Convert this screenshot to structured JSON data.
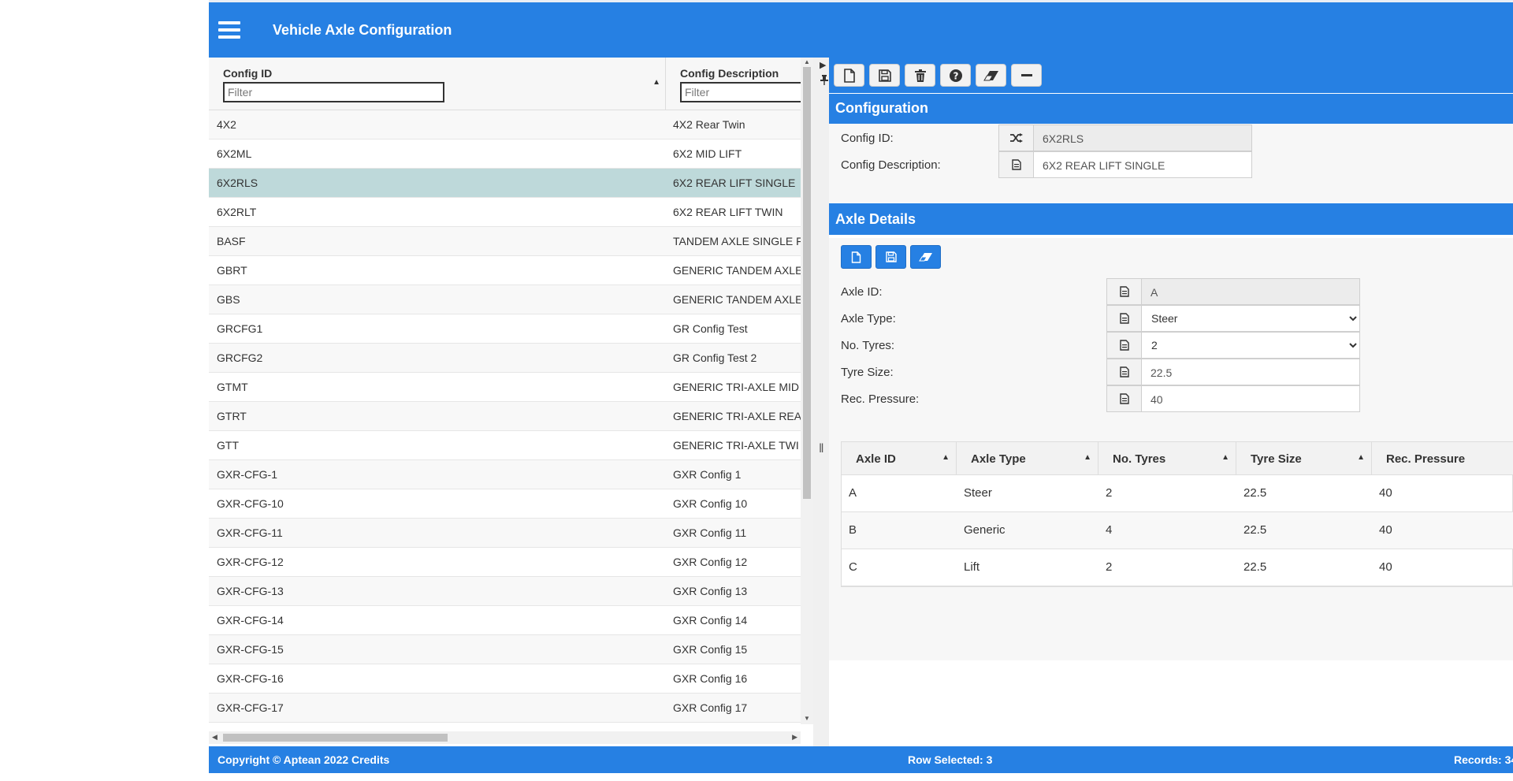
{
  "header": {
    "title": "Vehicle Axle Configuration"
  },
  "grid": {
    "columns": [
      {
        "label": "Config ID",
        "filter_placeholder": "Filter"
      },
      {
        "label": "Config Description",
        "filter_placeholder": "Filter"
      }
    ],
    "rows": [
      {
        "id": "4X2",
        "desc": "4X2 Rear Twin"
      },
      {
        "id": "6X2ML",
        "desc": "6X2 MID LIFT"
      },
      {
        "id": "6X2RLS",
        "desc": "6X2 REAR LIFT SINGLE"
      },
      {
        "id": "6X2RLT",
        "desc": "6X2 REAR LIFT TWIN"
      },
      {
        "id": "BASF",
        "desc": "TANDEM AXLE SINGLE F"
      },
      {
        "id": "GBRT",
        "desc": "GENERIC TANDEM AXLE"
      },
      {
        "id": "GBS",
        "desc": "GENERIC TANDEM AXLE"
      },
      {
        "id": "GRCFG1",
        "desc": "GR Config Test"
      },
      {
        "id": "GRCFG2",
        "desc": "GR Config Test 2"
      },
      {
        "id": "GTMT",
        "desc": "GENERIC TRI-AXLE MID"
      },
      {
        "id": "GTRT",
        "desc": "GENERIC TRI-AXLE REA"
      },
      {
        "id": "GTT",
        "desc": "GENERIC TRI-AXLE TWI"
      },
      {
        "id": "GXR-CFG-1",
        "desc": "GXR Config 1"
      },
      {
        "id": "GXR-CFG-10",
        "desc": "GXR Config 10"
      },
      {
        "id": "GXR-CFG-11",
        "desc": "GXR Config 11"
      },
      {
        "id": "GXR-CFG-12",
        "desc": "GXR Config 12"
      },
      {
        "id": "GXR-CFG-13",
        "desc": "GXR Config 13"
      },
      {
        "id": "GXR-CFG-14",
        "desc": "GXR Config 14"
      },
      {
        "id": "GXR-CFG-15",
        "desc": "GXR Config 15"
      },
      {
        "id": "GXR-CFG-16",
        "desc": "GXR Config 16"
      },
      {
        "id": "GXR-CFG-17",
        "desc": "GXR Config 17"
      }
    ],
    "selected_index": 2
  },
  "toolbar": {
    "icons": [
      "new-document-icon",
      "save-icon",
      "delete-icon",
      "help-icon",
      "eraser-icon",
      "minus-icon"
    ]
  },
  "configuration": {
    "title": "Configuration",
    "config_id_label": "Config ID:",
    "config_id_value": "6X2RLS",
    "config_desc_label": "Config Description:",
    "config_desc_value": "6X2 REAR LIFT SINGLE"
  },
  "axle_details": {
    "title": "Axle Details",
    "axle_id_label": "Axle ID:",
    "axle_id_value": "A",
    "axle_type_label": "Axle Type:",
    "axle_type_value": "Steer",
    "no_tyres_label": "No. Tyres:",
    "no_tyres_value": "2",
    "tyre_size_label": "Tyre Size:",
    "tyre_size_value": "22.5",
    "rec_pressure_label": "Rec. Pressure:",
    "rec_pressure_value": "40",
    "table": {
      "headers": [
        "Axle ID",
        "Axle Type",
        "No. Tyres",
        "Tyre Size",
        "Rec. Pressure"
      ],
      "rows": [
        [
          "A",
          "Steer",
          "2",
          "22.5",
          "40"
        ],
        [
          "B",
          "Generic",
          "4",
          "22.5",
          "40"
        ],
        [
          "C",
          "Lift",
          "2",
          "22.5",
          "40"
        ]
      ]
    }
  },
  "footer": {
    "copyright": "Copyright © Aptean 2022 Credits",
    "row_selected": "Row Selected: 3",
    "records": "Records: 34"
  },
  "colors": {
    "accent": "#2680e3",
    "selected_row": "#bed9da"
  }
}
